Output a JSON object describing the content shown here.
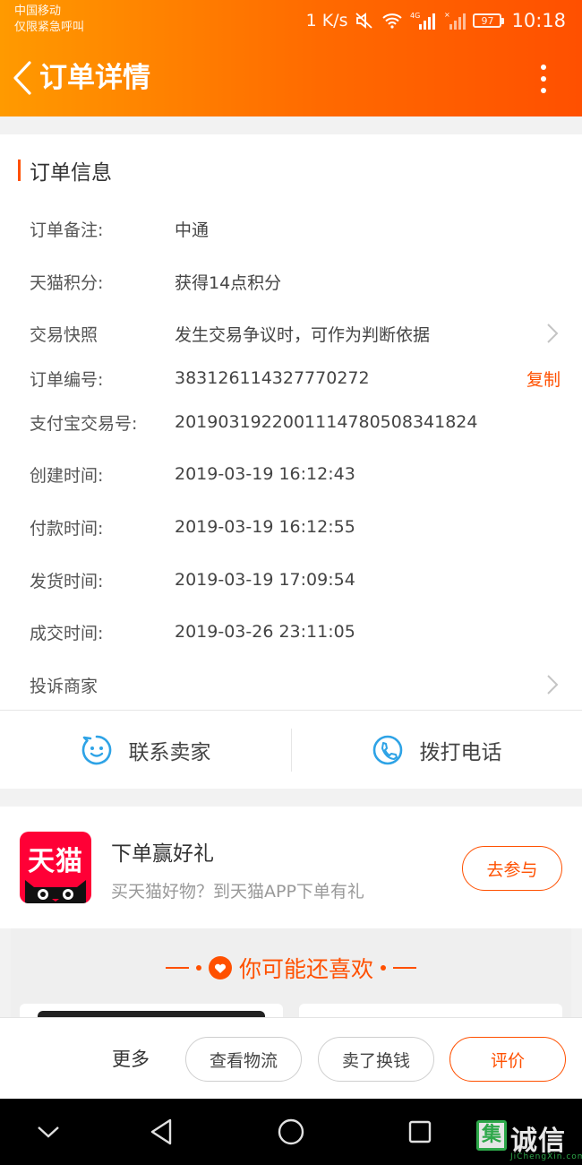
{
  "status_bar": {
    "carrier": "中国移动",
    "emergency": "仅限紧急呼叫",
    "speed": "1 K/s",
    "network": "4G",
    "battery": "97",
    "time": "10:18"
  },
  "header": {
    "title": "订单详情"
  },
  "order_info": {
    "section_title": "订单信息",
    "rows": [
      {
        "label": "订单备注:",
        "value": "中通"
      },
      {
        "label": "天猫积分:",
        "value": "获得14点积分"
      },
      {
        "label": "交易快照",
        "value": "发生交易争议时，可作为判断依据"
      },
      {
        "label": "订单编号:",
        "value": "383126114327770272",
        "action": "复制"
      },
      {
        "label": "支付宝交易号:",
        "value": "2019031922001114780508341824"
      },
      {
        "label": "创建时间:",
        "value": "2019-03-19 16:12:43"
      },
      {
        "label": "付款时间:",
        "value": "2019-03-19 16:12:55"
      },
      {
        "label": "发货时间:",
        "value": "2019-03-19 17:09:54"
      },
      {
        "label": "成交时间:",
        "value": "2019-03-26 23:11:05"
      },
      {
        "label": "投诉商家"
      }
    ]
  },
  "contact": {
    "seller": "联系卖家",
    "phone": "拨打电话"
  },
  "promo": {
    "logo_text": "天猫",
    "title": "下单赢好礼",
    "subtitle": "买天猫好物？到天猫APP下单有礼",
    "button": "去参与"
  },
  "recommend": {
    "title": "你可能还喜欢"
  },
  "bottom_actions": {
    "more": "更多",
    "logistics": "查看物流",
    "resell": "卖了换钱",
    "review": "评价"
  },
  "watermark": {
    "box": "集",
    "text": "诚信",
    "sub": "JiChengXin.com"
  },
  "colors": {
    "accent": "#ff5000",
    "header_start": "#ff9a00",
    "icon_blue": "#2ea3e6"
  }
}
